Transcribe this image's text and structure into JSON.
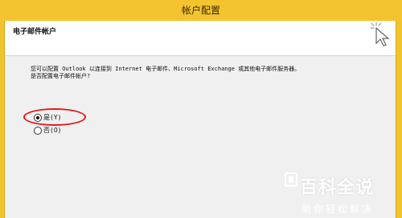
{
  "window": {
    "title": "帐户配置",
    "header": {
      "title": "电子邮件帐户"
    },
    "description_line1": "您可以配置 Outlook 以连接到 Internet 电子邮件、Microsoft Exchange 或其他电子邮件服务器。",
    "description_line2": "是否配置电子邮件帐户?",
    "options": [
      {
        "label": "是(Y)",
        "selected": true
      },
      {
        "label": "否(O)",
        "selected": false
      }
    ]
  },
  "watermark": {
    "brand": "百科全说",
    "tagline": "助你轻松解决"
  },
  "colors": {
    "titlebar": "#f4c430",
    "annotation": "#e01a1a",
    "dialog_bg": "#f0f0f0"
  }
}
